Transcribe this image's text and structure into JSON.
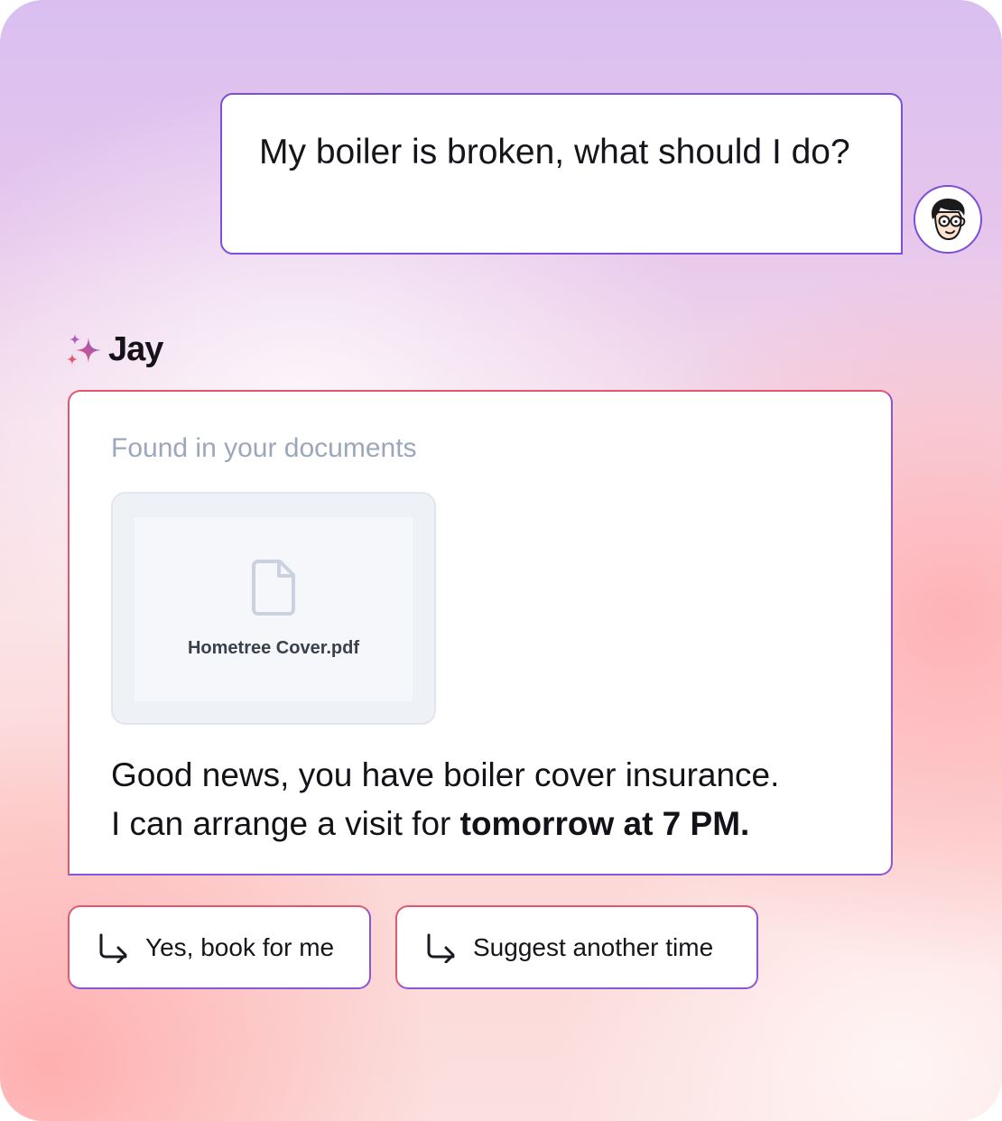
{
  "user_message": {
    "text": "My boiler is broken, what should I do?"
  },
  "assistant": {
    "name": "Jay",
    "card": {
      "found_label": "Found in your documents",
      "document": {
        "file_name": "Hometree Cover.pdf",
        "icon": "document-icon"
      },
      "reply_line1": "Good news, you have boiler cover insurance.",
      "reply_line2_prefix": "I can arrange a visit for ",
      "reply_line2_bold": "tomorrow at 7 PM."
    }
  },
  "quick_replies": [
    {
      "label": "Yes, book for me",
      "icon": "reply-arrow-icon"
    },
    {
      "label": "Suggest another time",
      "icon": "reply-arrow-icon"
    }
  ],
  "colors": {
    "accent_purple": "#7b4fd6",
    "accent_pink": "#e0576f",
    "muted_text": "#9ba7ba"
  }
}
